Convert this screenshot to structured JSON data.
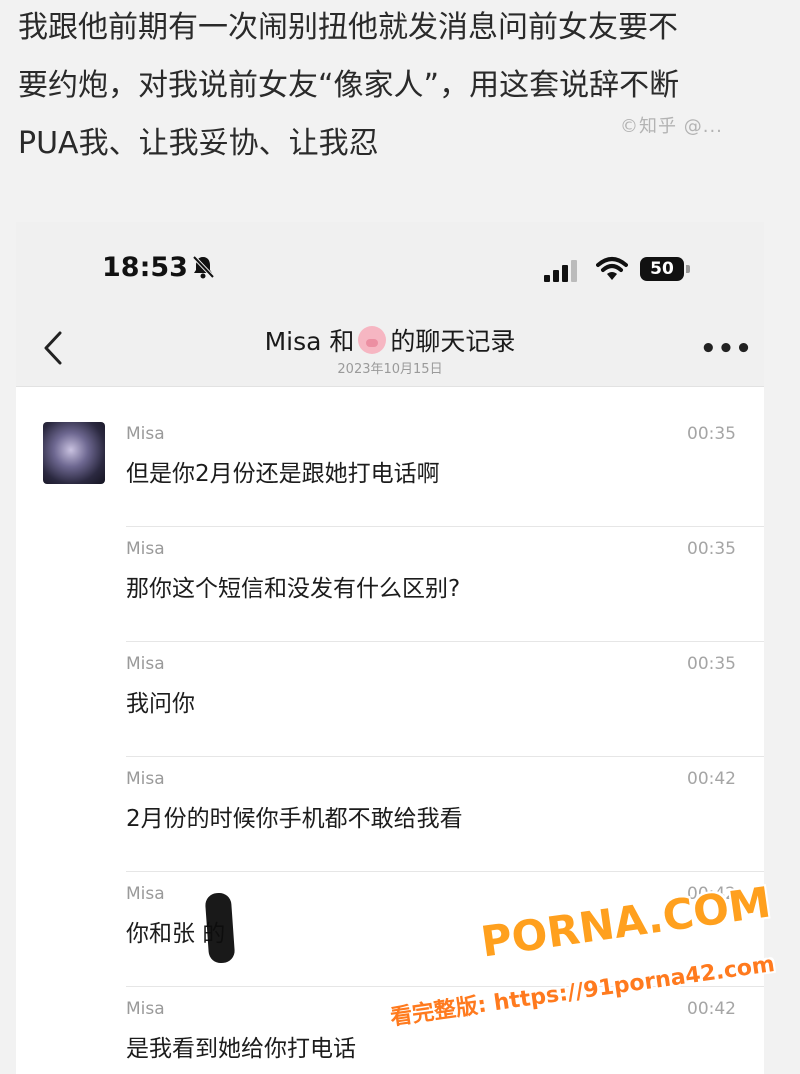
{
  "caption": {
    "lines": [
      "我跟他前期有一次闹别扭他就发消息问前女友要不",
      "要约炮，对我说前女友“像家人”，用这套说辞不断",
      "PUA我、让我妥协、让我忍"
    ],
    "watermark": "©知乎 @..."
  },
  "status_bar": {
    "time": "18:53",
    "battery": "50"
  },
  "nav": {
    "title_prefix": "Misa 和",
    "title_suffix": "的聊天记录",
    "date": "2023年10月15日",
    "more": "•••"
  },
  "messages": [
    {
      "sender": "Misa",
      "time": "00:35",
      "text": "但是你2月份还是跟她打电话啊"
    },
    {
      "sender": "Misa",
      "time": "00:35",
      "text": "那你这个短信和没发有什么区别?"
    },
    {
      "sender": "Misa",
      "time": "00:35",
      "text": "我问你"
    },
    {
      "sender": "Misa",
      "time": "00:42",
      "text": "2月份的时候你手机都不敢给我看"
    },
    {
      "sender": "Misa",
      "time": "00:42",
      "text": "你和张  的"
    },
    {
      "sender": "Misa",
      "time": "00:42",
      "text": "是我看到她给你打电话"
    }
  ],
  "watermark": {
    "brand": "PORNA.COM",
    "url_line": "看完整版: https://91porna42.com"
  },
  "icons": {
    "back": "chevron-left-icon",
    "silent": "bell-slash-icon",
    "signal": "cellular-signal-icon",
    "wifi": "wifi-icon",
    "battery": "battery-icon",
    "avatar": "avatar"
  }
}
